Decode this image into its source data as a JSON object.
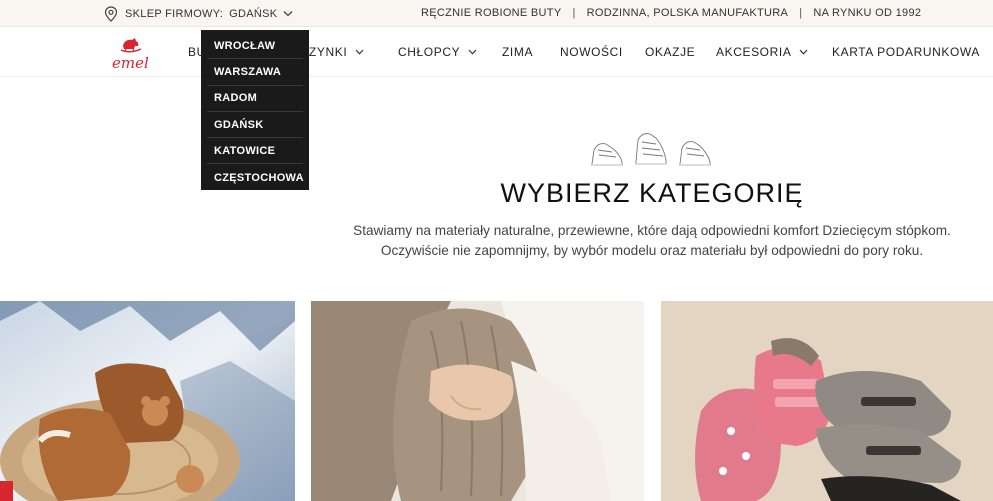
{
  "topbar": {
    "store_label": "SKLEP FIRMOWY:",
    "store_city": "GDAŃSK",
    "usp": [
      "RĘCZNIE ROBIONE BUTY",
      "RODZINNA, POLSKA MANUFAKTURA",
      "NA RYNKU OD 1992"
    ],
    "separator": "|"
  },
  "logo": {
    "text": "emel"
  },
  "nav": {
    "items": [
      {
        "label": "BU"
      },
      {
        "label": "DZIEWCZYNKI"
      },
      {
        "label": "CHŁOPCY"
      },
      {
        "label": "ZIMA"
      },
      {
        "label": "NOWOŚCI"
      },
      {
        "label": "OKAZJE"
      },
      {
        "label": "AKCESORIA"
      },
      {
        "label": "KARTA PODARUNKOWA"
      }
    ]
  },
  "dropdown": {
    "items": [
      "WROCŁAW",
      "WARSZAWA",
      "RADOM",
      "GDAŃSK",
      "KATOWICE",
      "CZĘSTOCHOWA"
    ]
  },
  "category": {
    "title": "WYBIERZ KATEGORIĘ",
    "description_line1": "Stawiamy na materiały naturalne, przewiewne, które dają odpowiedni komfort Dziecięcym stópkom.",
    "description_line2": "Oczywiście nie zapomnijmy, by wybór modelu oraz materiału był odpowiedni do pory roku."
  },
  "colors": {
    "brand_red": "#d6262f",
    "topbar_bg": "#f9f5f1",
    "dropdown_bg": "#1a1a1a"
  }
}
